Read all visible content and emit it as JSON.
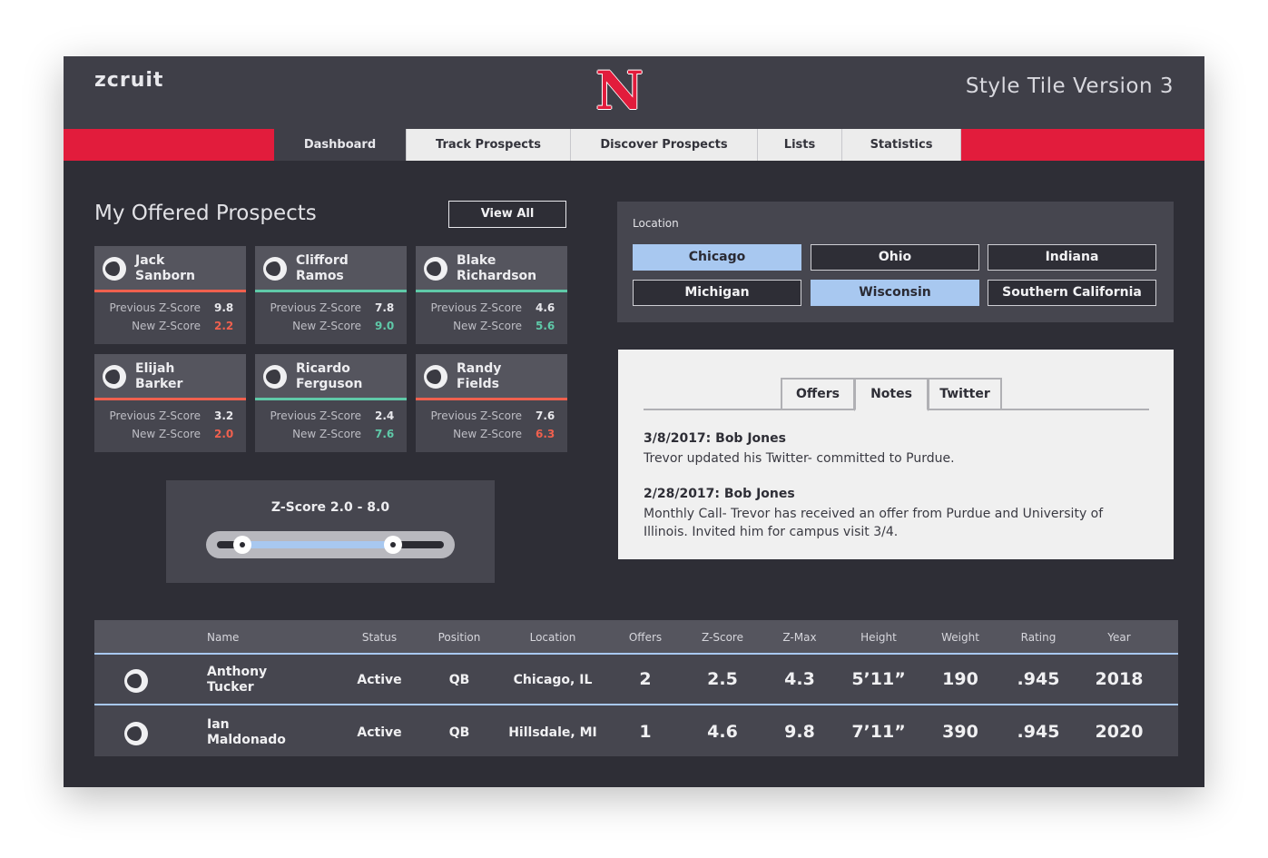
{
  "header": {
    "logo_text": "zcruit",
    "team_logo": "N",
    "style_title": "Style Tile Version 3"
  },
  "nav": {
    "tabs": [
      {
        "label": "Dashboard",
        "active": true
      },
      {
        "label": "Track Prospects"
      },
      {
        "label": "Discover Prospects"
      },
      {
        "label": "Lists"
      },
      {
        "label": "Statistics"
      }
    ]
  },
  "prospects": {
    "title": "My Offered Prospects",
    "view_all": "View All",
    "previous_label": "Previous Z-Score",
    "new_label": "New Z-Score",
    "cards": [
      {
        "first": "Jack",
        "last": "Sanborn",
        "previous": "9.8",
        "new": "2.2",
        "trend": "down"
      },
      {
        "first": "Clifford",
        "last": "Ramos",
        "previous": "7.8",
        "new": "9.0",
        "trend": "up"
      },
      {
        "first": "Blake",
        "last": "Richardson",
        "previous": "4.6",
        "new": "5.6",
        "trend": "up"
      },
      {
        "first": "Elijah",
        "last": "Barker",
        "previous": "3.2",
        "new": "2.0",
        "trend": "down"
      },
      {
        "first": "Ricardo",
        "last": "Ferguson",
        "previous": "2.4",
        "new": "7.6",
        "trend": "up"
      },
      {
        "first": "Randy",
        "last": "Fields",
        "previous": "7.6",
        "new": "6.3",
        "trend": "down"
      }
    ]
  },
  "zscore_filter": {
    "title": "Z-Score 2.0 - 8.0",
    "min": 2.0,
    "max": 8.0
  },
  "location": {
    "label": "Location",
    "options": [
      {
        "label": "Chicago",
        "selected": true
      },
      {
        "label": "Ohio",
        "selected": false
      },
      {
        "label": "Indiana",
        "selected": false
      },
      {
        "label": "Michigan",
        "selected": false
      },
      {
        "label": "Wisconsin",
        "selected": true
      },
      {
        "label": "Southern California",
        "selected": false
      }
    ]
  },
  "notes": {
    "tabs": [
      {
        "label": "Offers"
      },
      {
        "label": "Notes",
        "active": true
      },
      {
        "label": "Twitter"
      }
    ],
    "entries": [
      {
        "title": "3/8/2017: Bob Jones",
        "lines": [
          "Trevor updated his Twitter- committed to Purdue."
        ]
      },
      {
        "title": "2/28/2017: Bob Jones",
        "lines": [
          "Monthly Call- Trevor has received an offer from Purdue and University of",
          "Illinois. Invited him for campus visit 3/4."
        ]
      }
    ]
  },
  "table": {
    "columns": [
      "Name",
      "Status",
      "Position",
      "Location",
      "Offers",
      "Z-Score",
      "Z-Max",
      "Height",
      "Weight",
      "Rating",
      "Year"
    ],
    "rows": [
      {
        "first": "Anthony",
        "last": "Tucker",
        "status": "Active",
        "position": "QB",
        "location": "Chicago, IL",
        "offers": "2",
        "zscore": "2.5",
        "zmax": "4.3",
        "height": "5’11”",
        "weight": "190",
        "rating": ".945",
        "year": "2018"
      },
      {
        "first": "Ian",
        "last": "Maldonado",
        "status": "Active",
        "position": "QB",
        "location": "Hillsdale, MI",
        "offers": "1",
        "zscore": "4.6",
        "zmax": "9.8",
        "height": "7’11”",
        "weight": "390",
        "rating": ".945",
        "year": "2020"
      }
    ]
  },
  "colors": {
    "brand_red": "#e21c3c",
    "accent_blue": "#a8c8f0",
    "up_green": "#5fc9a8",
    "down_red": "#f0604e"
  }
}
